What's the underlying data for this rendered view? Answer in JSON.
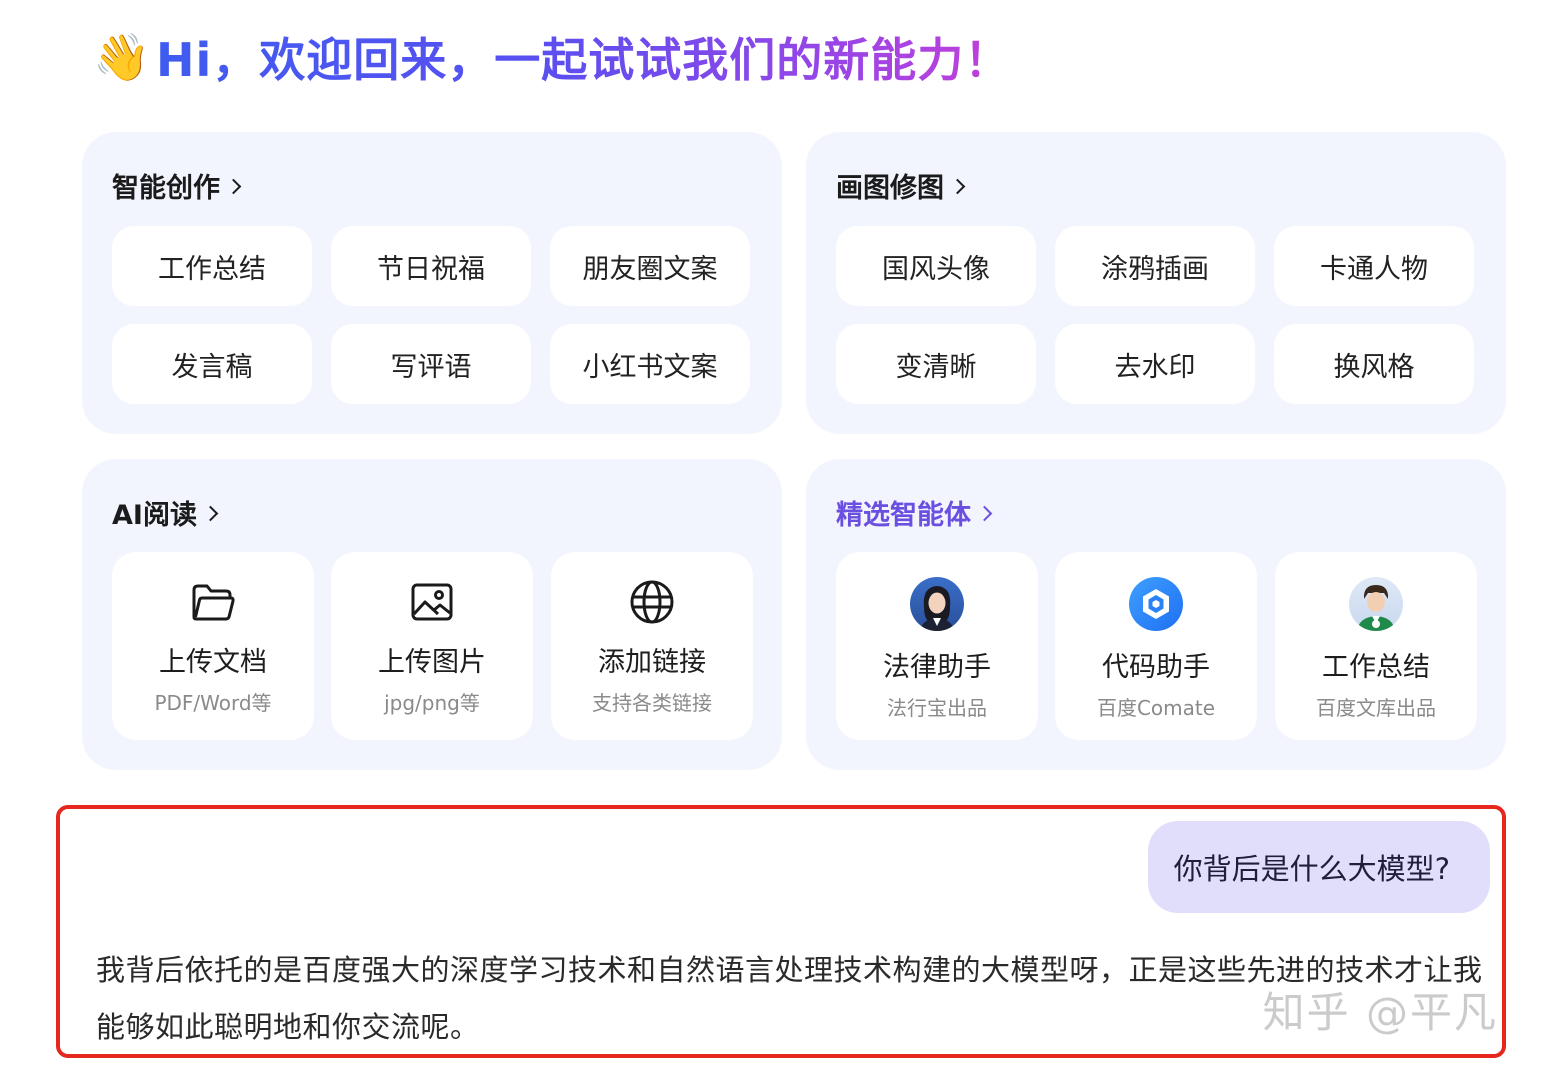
{
  "greeting": {
    "emoji": "👋",
    "text": "Hi，欢迎回来，一起试试我们的新能力！"
  },
  "smart_creation": {
    "title": "智能创作",
    "items": [
      "工作总结",
      "节日祝福",
      "朋友圈文案",
      "发言稿",
      "写评语",
      "小红书文案"
    ]
  },
  "image_edit": {
    "title": "画图修图",
    "items": [
      "国风头像",
      "涂鸦插画",
      "卡通人物",
      "变清晰",
      "去水印",
      "换风格"
    ]
  },
  "ai_reading": {
    "title": "AI阅读",
    "cards": [
      {
        "icon": "folder-icon",
        "title": "上传文档",
        "sub": "PDF/Word等"
      },
      {
        "icon": "image-icon",
        "title": "上传图片",
        "sub": "jpg/png等"
      },
      {
        "icon": "globe-icon",
        "title": "添加链接",
        "sub": "支持各类链接"
      }
    ]
  },
  "agents": {
    "title": "精选智能体",
    "accent": "#6a4fe0",
    "cards": [
      {
        "title": "法律助手",
        "sub": "法行宝出品"
      },
      {
        "title": "代码助手",
        "sub": "百度Comate"
      },
      {
        "title": "工作总结",
        "sub": "百度文库出品"
      }
    ]
  },
  "chat": {
    "question": "你背后是什么大模型?",
    "answer": "我背后依托的是百度强大的深度学习技术和自然语言处理技术构建的大模型呀，正是这些先进的技术才让我能够如此聪明地和你交流呢。",
    "highlight_color": "#e5271e"
  },
  "watermark": "知乎 @平凡"
}
